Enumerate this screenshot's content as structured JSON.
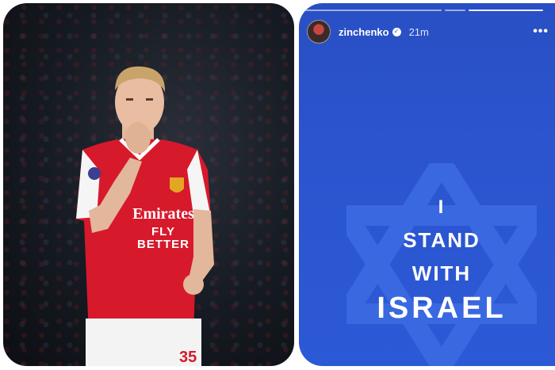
{
  "story": {
    "username": "zinchenko",
    "time_ago": "21m",
    "more_label": "•••",
    "verified_label": "✓",
    "lines": [
      "I",
      "STAND",
      "WITH",
      "ISRAEL"
    ]
  },
  "photo": {
    "jersey_sponsor_line1": "Emirates",
    "jersey_sponsor_line2": "FLY BETTER",
    "shirt_number": "35"
  },
  "colors": {
    "story_background": "#2b55cf",
    "star": "#3a68e0",
    "jersey_red": "#d7192c"
  },
  "icons": {
    "more": "more-options-icon",
    "verified": "verified-badge-icon",
    "star": "star-of-david-icon"
  }
}
